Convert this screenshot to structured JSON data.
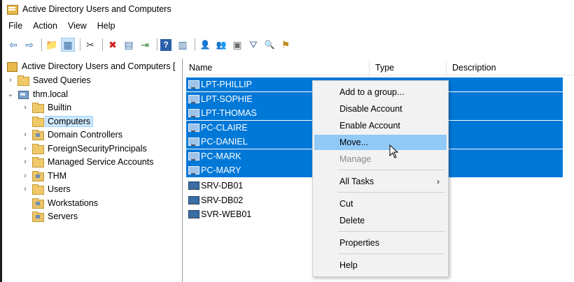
{
  "window": {
    "title": "Active Directory Users and Computers"
  },
  "menubar": {
    "items": [
      "File",
      "Action",
      "View",
      "Help"
    ]
  },
  "toolbar": {
    "buttons": [
      {
        "icon": "back-arrow",
        "glyph": "⇦"
      },
      {
        "icon": "forward-arrow",
        "glyph": "⇨"
      },
      {
        "icon": "up-folder",
        "glyph": "📁"
      },
      {
        "icon": "show-hide-console-tree",
        "glyph": "▦"
      },
      {
        "icon": "cut",
        "glyph": "✂"
      },
      {
        "icon": "delete",
        "glyph": "✖"
      },
      {
        "icon": "properties",
        "glyph": "▤"
      },
      {
        "icon": "export-list",
        "glyph": "⇥"
      },
      {
        "icon": "help",
        "glyph": "?"
      },
      {
        "icon": "console-view",
        "glyph": "▥"
      },
      {
        "icon": "new-user",
        "glyph": "👤"
      },
      {
        "icon": "new-group",
        "glyph": "👥"
      },
      {
        "icon": "new-ou",
        "glyph": "▣"
      },
      {
        "icon": "filter",
        "glyph": "⛛"
      },
      {
        "icon": "find",
        "glyph": "🔍"
      },
      {
        "icon": "add-to-group",
        "glyph": "⚑"
      }
    ]
  },
  "tree": {
    "root": "Active Directory Users and Computers [",
    "saved_queries": "Saved Queries",
    "domain": "thm.local",
    "builtin": "Builtin",
    "computers": "Computers",
    "domain_controllers": "Domain Controllers",
    "foreign": "ForeignSecurityPrincipals",
    "msa": "Managed Service Accounts",
    "thm": "THM",
    "users": "Users",
    "workstations": "Workstations",
    "servers": "Servers"
  },
  "list": {
    "columns": {
      "name": "Name",
      "type": "Type",
      "description": "Description"
    },
    "rows": [
      {
        "name": "LPT-PHILLIP",
        "selected": true
      },
      {
        "name": "LPT-SOPHIE",
        "selected": true
      },
      {
        "name": "LPT-THOMAS",
        "selected": true
      },
      {
        "name": "PC-CLAIRE",
        "selected": true
      },
      {
        "name": "PC-DANIEL",
        "selected": true
      },
      {
        "name": "PC-MARK",
        "selected": true
      },
      {
        "name": "PC-MARY",
        "selected": true
      },
      {
        "name": "SRV-DB01",
        "selected": false
      },
      {
        "name": "SRV-DB02",
        "selected": false
      },
      {
        "name": "SVR-WEB01",
        "selected": false
      }
    ]
  },
  "context_menu": {
    "add_to_group": "Add to a group...",
    "disable_account": "Disable Account",
    "enable_account": "Enable Account",
    "move": "Move...",
    "manage": "Manage",
    "all_tasks": "All Tasks",
    "cut": "Cut",
    "delete": "Delete",
    "properties": "Properties",
    "help": "Help"
  },
  "colors": {
    "selection": "#0078d7",
    "menu_hover": "#91c9f7",
    "tree_selection": "#cce8ff"
  }
}
